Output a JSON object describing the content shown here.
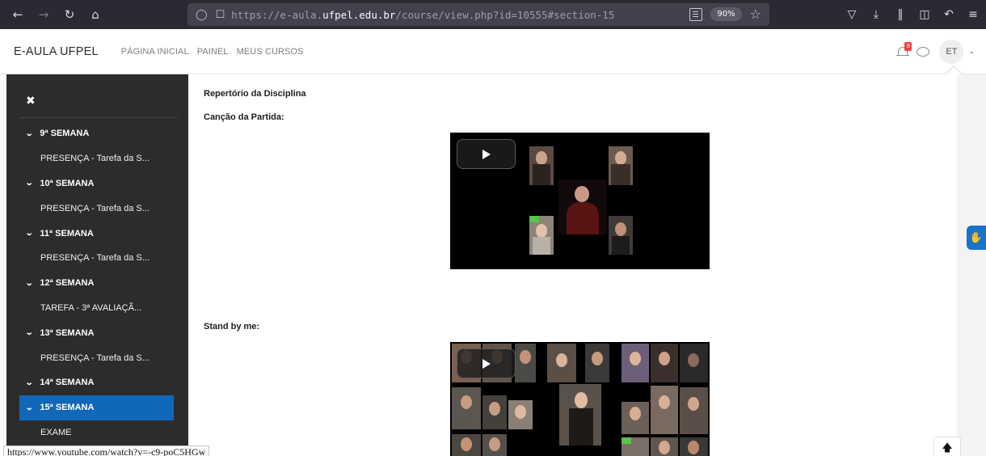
{
  "browser": {
    "url_prefix": "https://e-aula.",
    "url_domain": "ufpel.edu.br",
    "url_suffix": "/course/view.php?id=10555#section-15",
    "zoom": "90%"
  },
  "site": {
    "brand": "E-AULA UFPEL",
    "nav_links": [
      "PÁGINA INICIAL",
      "PAINEL",
      "MEUS CURSOS"
    ],
    "notification_count": "8",
    "user_initials": "ET"
  },
  "drawer": {
    "items": [
      {
        "type": "section",
        "label": "9ª SEMANA"
      },
      {
        "type": "activity",
        "label": "PRESENÇA - Tarefa da S..."
      },
      {
        "type": "section",
        "label": "10ª SEMANA"
      },
      {
        "type": "activity",
        "label": "PRESENÇA - Tarefa da S..."
      },
      {
        "type": "section",
        "label": "11ª SEMANA"
      },
      {
        "type": "activity",
        "label": "PRESENÇA - Tarefa da S..."
      },
      {
        "type": "section",
        "label": "12ª SEMANA"
      },
      {
        "type": "activity",
        "label": "TAREFA - 3ª AVALIAÇÃ..."
      },
      {
        "type": "section",
        "label": "13ª SEMANA"
      },
      {
        "type": "activity",
        "label": "PRESENÇA - Tarefa da S..."
      },
      {
        "type": "section",
        "label": "14ª SEMANA"
      },
      {
        "type": "section",
        "label": "15ª SEMANA",
        "active": true
      },
      {
        "type": "activity",
        "label": "EXAME"
      }
    ]
  },
  "content": {
    "heading": "Repertório da Disciplina",
    "song1_label": "Canção da Partida:",
    "song2_label": "Stand by me:"
  },
  "status_bar": {
    "link": "https://www.youtube.com/watch?v=-c9-poC5HGw"
  },
  "colors": {
    "drawer_bg": "#2c2c2c",
    "active_section": "#1167b8",
    "browser_chrome": "#2b2a33"
  }
}
